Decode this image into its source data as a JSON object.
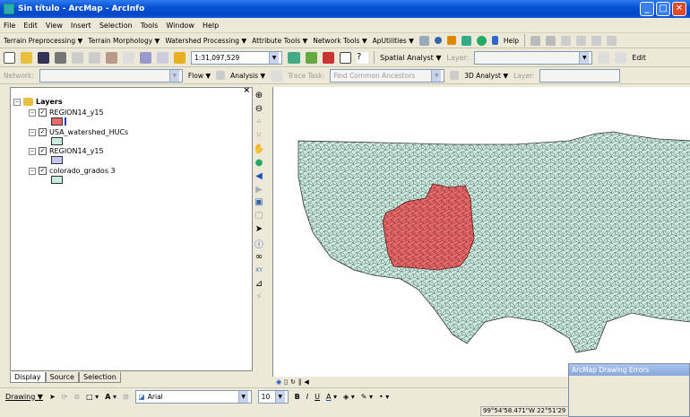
{
  "window": {
    "title": "Sin título - ArcMap - ArcInfo"
  },
  "menu": [
    "File",
    "Edit",
    "View",
    "Insert",
    "Selection",
    "Tools",
    "Window",
    "Help"
  ],
  "toolbar1": [
    "Terrain Preprocessing ▼",
    "Terrain Morphology ▼",
    "Watershed Processing ▼",
    "Attribute Tools ▼",
    "Network Tools ▼",
    "ApUtilities ▼",
    "Help"
  ],
  "standard": {
    "scale": "1:31,097,529",
    "spatial_analyst": "Spatial Analyst ▼",
    "layer_label": "Layer:",
    "edit": "Edit"
  },
  "utility_network": {
    "network_label": "Network:",
    "flow": "Flow ▼",
    "analysis": "Analysis ▼",
    "trace_task": "Trace Task:",
    "trace_value": "Find Common Ancestors",
    "analyst_3d": "3D Analyst ▼",
    "layer_label": "Layer:"
  },
  "toc": {
    "root": "Layers",
    "layers": [
      {
        "name": "REGION14_y15",
        "swatch": "#e86a6a"
      },
      {
        "name": "USA_watershed_HUCs",
        "swatch": "#c8ece0"
      },
      {
        "name": "REGION14_y15",
        "swatch": "#c4c8f0"
      },
      {
        "name": "colorado_grados 3",
        "swatch": "#c8ece0"
      }
    ],
    "tabs": [
      "Display",
      "Source",
      "Selection"
    ]
  },
  "drawing": {
    "drawing": "Drawing ▼",
    "font": "Arial",
    "size": "10",
    "bold": "B",
    "italic": "I",
    "underline": "U"
  },
  "status": {
    "coords": "99°54'58.471\"W  22°51'29"
  },
  "error_panel": {
    "title": "ArcMap Drawing Errors"
  },
  "colors": {
    "watershed_fill": "#c8ece0",
    "region_fill": "#e86a6a",
    "outline": "#333333"
  }
}
